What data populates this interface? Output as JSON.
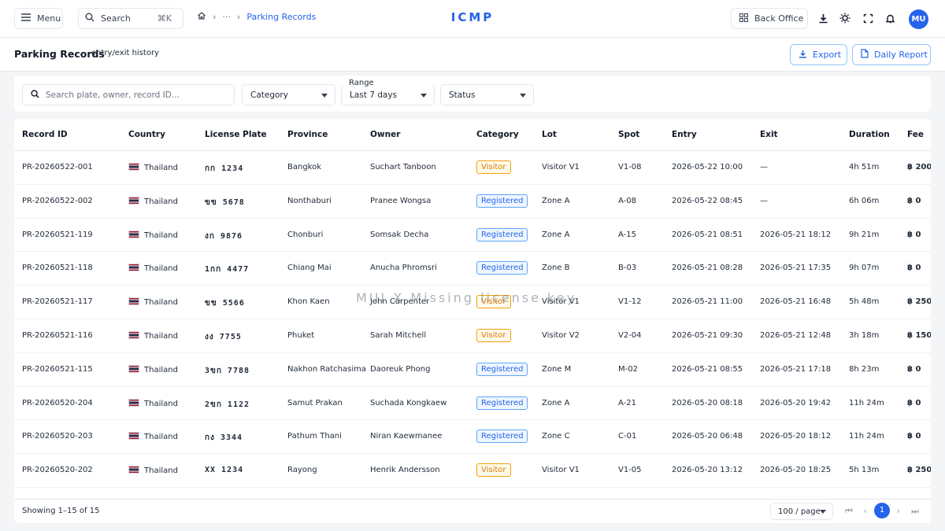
{
  "topbar": {
    "menu_label": "Menu",
    "search_label": "Search",
    "search_shortcut": "⌘K",
    "breadcrumb_ellipsis": "···",
    "breadcrumb_current": "Parking Records",
    "brand": "ICMP",
    "back_office_label": "Back Office",
    "avatar_initials": "MU"
  },
  "header": {
    "title": "Parking Records",
    "subtitle": "entry/exit history",
    "export_label": "Export",
    "daily_report_label": "Daily Report"
  },
  "filters": {
    "search_placeholder": "Search plate, owner, record ID...",
    "category_label": "Category",
    "range_label": "Range",
    "range_value": "Last 7 days",
    "status_label": "Status"
  },
  "table": {
    "columns": [
      "Record ID",
      "Country",
      "License Plate",
      "Province",
      "Owner",
      "Category",
      "Lot",
      "Spot",
      "Entry",
      "Exit",
      "Duration",
      "Fee"
    ],
    "rows": [
      {
        "id": "PR-20260522-001",
        "country": "Thailand",
        "plate": "กก 1234",
        "province": "Bangkok",
        "owner": "Suchart Tanboon",
        "category": "Visitor",
        "lot": "Visitor V1",
        "spot": "V1-08",
        "entry": "2026-05-22 10:00",
        "exit": "—",
        "duration": "4h 51m",
        "fee": "฿ 200"
      },
      {
        "id": "PR-20260522-002",
        "country": "Thailand",
        "plate": "ขข 5678",
        "province": "Nonthaburi",
        "owner": "Pranee Wongsa",
        "category": "Registered",
        "lot": "Zone A",
        "spot": "A-08",
        "entry": "2026-05-22 08:45",
        "exit": "—",
        "duration": "6h 06m",
        "fee": "฿ 0"
      },
      {
        "id": "PR-20260521-119",
        "country": "Thailand",
        "plate": "งก 9876",
        "province": "Chonburi",
        "owner": "Somsak Decha",
        "category": "Registered",
        "lot": "Zone A",
        "spot": "A-15",
        "entry": "2026-05-21 08:51",
        "exit": "2026-05-21 18:12",
        "duration": "9h 21m",
        "fee": "฿ 0"
      },
      {
        "id": "PR-20260521-118",
        "country": "Thailand",
        "plate": "1กก 4477",
        "province": "Chiang Mai",
        "owner": "Anucha Phromsri",
        "category": "Registered",
        "lot": "Zone B",
        "spot": "B-03",
        "entry": "2026-05-21 08:28",
        "exit": "2026-05-21 17:35",
        "duration": "9h 07m",
        "fee": "฿ 0"
      },
      {
        "id": "PR-20260521-117",
        "country": "Thailand",
        "plate": "ขข 5566",
        "province": "Khon Kaen",
        "owner": "John Carpenter",
        "category": "Visitor",
        "lot": "Visitor V1",
        "spot": "V1-12",
        "entry": "2026-05-21 11:00",
        "exit": "2026-05-21 16:48",
        "duration": "5h 48m",
        "fee": "฿ 250"
      },
      {
        "id": "PR-20260521-116",
        "country": "Thailand",
        "plate": "งง 7755",
        "province": "Phuket",
        "owner": "Sarah Mitchell",
        "category": "Visitor",
        "lot": "Visitor V2",
        "spot": "V2-04",
        "entry": "2026-05-21 09:30",
        "exit": "2026-05-21 12:48",
        "duration": "3h 18m",
        "fee": "฿ 150"
      },
      {
        "id": "PR-20260521-115",
        "country": "Thailand",
        "plate": "3ขก 7788",
        "province": "Nakhon Ratchasima",
        "owner": "Daoreuk Phong",
        "category": "Registered",
        "lot": "Zone M",
        "spot": "M-02",
        "entry": "2026-05-21 08:55",
        "exit": "2026-05-21 17:18",
        "duration": "8h 23m",
        "fee": "฿ 0"
      },
      {
        "id": "PR-20260520-204",
        "country": "Thailand",
        "plate": "2ขก 1122",
        "province": "Samut Prakan",
        "owner": "Suchada Kongkaew",
        "category": "Registered",
        "lot": "Zone A",
        "spot": "A-21",
        "entry": "2026-05-20 08:18",
        "exit": "2026-05-20 19:42",
        "duration": "11h 24m",
        "fee": "฿ 0"
      },
      {
        "id": "PR-20260520-203",
        "country": "Thailand",
        "plate": "กง 3344",
        "province": "Pathum Thani",
        "owner": "Niran Kaewmanee",
        "category": "Registered",
        "lot": "Zone C",
        "spot": "C-01",
        "entry": "2026-05-20 06:48",
        "exit": "2026-05-20 18:12",
        "duration": "11h 24m",
        "fee": "฿ 0"
      },
      {
        "id": "PR-20260520-202",
        "country": "Thailand",
        "plate": "XX 1234",
        "province": "Rayong",
        "owner": "Henrik Andersson",
        "category": "Visitor",
        "lot": "Visitor V1",
        "spot": "V1-05",
        "entry": "2026-05-20 13:12",
        "exit": "2026-05-20 18:25",
        "duration": "5h 13m",
        "fee": "฿ 250"
      }
    ]
  },
  "footer": {
    "showing": "Showing 1–15 of 15",
    "per_page": "100 / page",
    "current_page": "1"
  },
  "watermark": "MUI X Missing license key",
  "colors": {
    "accent": "#2563eb",
    "visitor": "#d97706",
    "registered": "#2563eb"
  }
}
